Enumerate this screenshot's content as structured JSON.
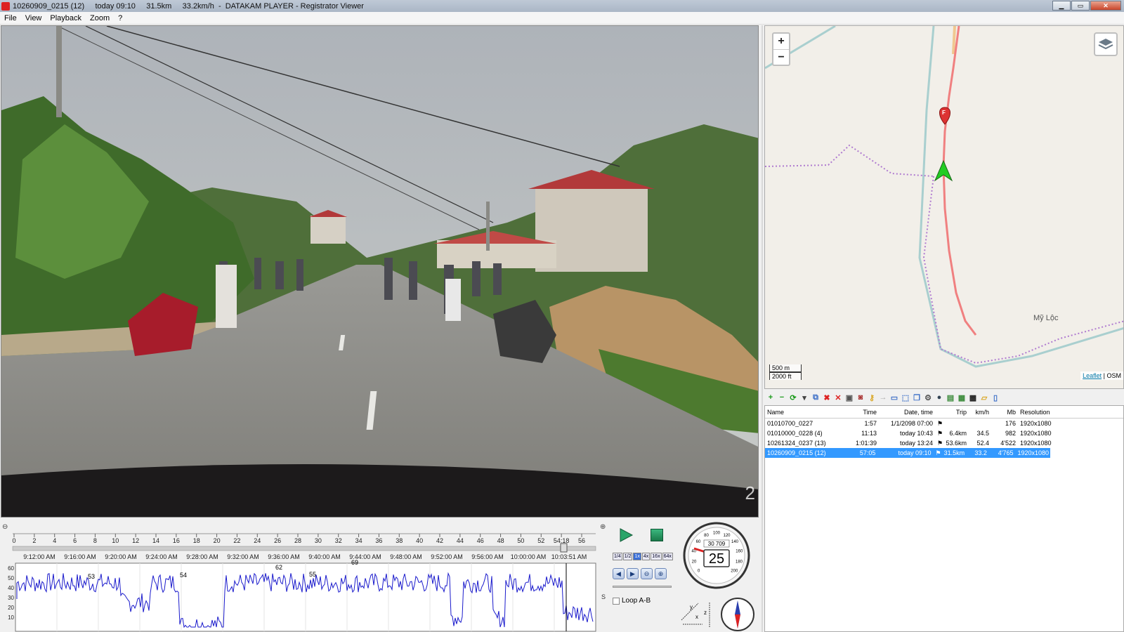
{
  "window": {
    "title_file": "10260909_0215 (12)",
    "title_time": "today 09:10",
    "title_trip": "31.5km",
    "title_speed": "33.2km/h",
    "title_app": "DATAKAM PLAYER - Registrator Viewer"
  },
  "menu": [
    "File",
    "View",
    "Playback",
    "Zoom",
    "?"
  ],
  "video": {
    "camera_number": "2"
  },
  "map": {
    "zoom_in": "+",
    "zoom_out": "−",
    "scale_metric": "500 m",
    "scale_imperial": "2000 ft",
    "place_label": "Mỹ Lộc",
    "attribution_link": "Leaflet",
    "attribution_sep": " | ",
    "attribution_osm": "OSM",
    "marker_label": "F",
    "route_color": "#f08080",
    "boundary_color": "#b07bd0",
    "river_color": "#a9cfcf",
    "arrow_color": "#22cc22"
  },
  "file_list": {
    "headers": {
      "name": "Name",
      "time": "Time",
      "date": "Date, time",
      "trip": "Trip",
      "kmh": "km/h",
      "mb": "Mb",
      "res": "Resolution"
    },
    "rows": [
      {
        "name": "01010700_0227",
        "time": "1:57",
        "date": "1/1/2098 07:00",
        "trip": "",
        "kmh": "",
        "mb": "176",
        "res": "1920x1080"
      },
      {
        "name": "01010000_0228 (4)",
        "time": "11:13",
        "date": "today 10:43",
        "trip": "6.4km",
        "kmh": "34.5",
        "mb": "982",
        "res": "1920x1080"
      },
      {
        "name": "10261324_0237 (13)",
        "time": "1:01:39",
        "date": "today 13:24",
        "trip": "53.6km",
        "kmh": "52.4",
        "mb": "4'522",
        "res": "1920x1080"
      },
      {
        "name": "10260909_0215 (12)",
        "time": "57:05",
        "date": "today 09:10",
        "trip": "31.5km",
        "kmh": "33.2",
        "mb": "4'765",
        "res": "1920x1080"
      }
    ],
    "selected_index": 3
  },
  "timeline": {
    "minute_ticks": [
      "0",
      "2",
      "4",
      "6",
      "8",
      "10",
      "12",
      "14",
      "16",
      "18",
      "20",
      "22",
      "24",
      "26",
      "28",
      "30",
      "32",
      "34",
      "36",
      "38",
      "40",
      "42",
      "44",
      "46",
      "48",
      "50",
      "52",
      "54:18",
      "56"
    ],
    "clock_ticks": [
      "9:12:00 AM",
      "9:16:00 AM",
      "9:20:00 AM",
      "9:24:00 AM",
      "9:28:00 AM",
      "9:32:00 AM",
      "9:36:00 AM",
      "9:40:00 AM",
      "9:44:00 AM",
      "9:48:00 AM",
      "9:52:00 AM",
      "9:56:00 AM",
      "10:00:00 AM",
      "10:03:51 AM"
    ],
    "y_ticks": [
      "60",
      "50",
      "40",
      "30",
      "20",
      "10"
    ],
    "peaks": [
      "53",
      "54",
      "62",
      "55",
      "69"
    ],
    "axis_unit": "S",
    "line_color": "#1a1acc"
  },
  "controls": {
    "speeds": [
      "1/4",
      "1/2",
      "1x",
      "4x",
      "16x",
      "64x"
    ],
    "active_speed": "1x",
    "loop_label": "Loop A-B"
  },
  "gauges": {
    "speed_value": "25",
    "odometer": "30 709",
    "dial_labels": [
      "0",
      "20",
      "40",
      "60",
      "80",
      "100",
      "120",
      "140",
      "160",
      "180",
      "200"
    ],
    "axis_x": "x",
    "axis_y": "y",
    "axis_z": "z"
  }
}
